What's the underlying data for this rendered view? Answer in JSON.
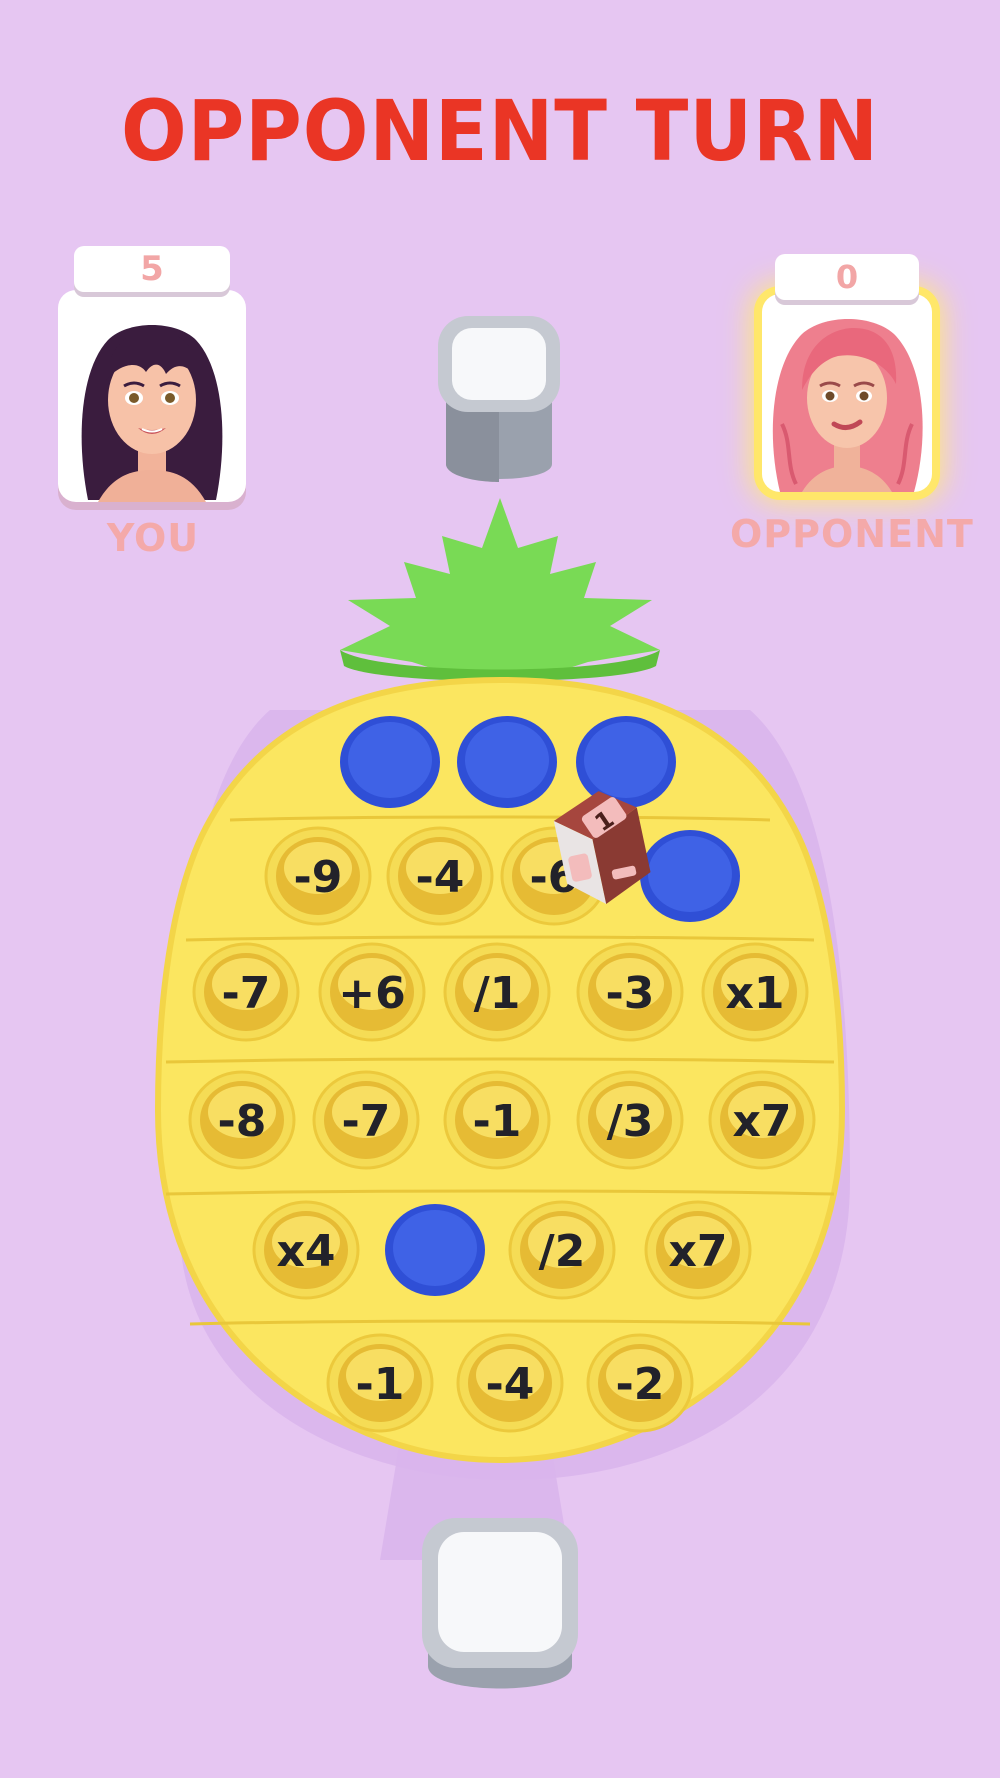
{
  "header": {
    "turn_label": "OPPONENT TURN"
  },
  "players": {
    "you": {
      "score": "5",
      "label": "YOU",
      "active": false
    },
    "opponent": {
      "score": "0",
      "label": "OPPONENT",
      "active": true
    }
  },
  "board": {
    "shape": "pineapple",
    "rows": [
      {
        "cells": [
          {
            "popped": true
          },
          {
            "popped": true
          },
          {
            "popped": true
          }
        ]
      },
      {
        "cells": [
          {
            "value": "-9"
          },
          {
            "value": "-4"
          },
          {
            "value": "-6"
          },
          {
            "popped": true
          }
        ]
      },
      {
        "cells": [
          {
            "value": "-7"
          },
          {
            "value": "+6"
          },
          {
            "value": "/1"
          },
          {
            "value": "-3"
          },
          {
            "value": "x1"
          }
        ]
      },
      {
        "cells": [
          {
            "value": "-8"
          },
          {
            "value": "-7"
          },
          {
            "value": "-1"
          },
          {
            "value": "/3"
          },
          {
            "value": "x7"
          }
        ]
      },
      {
        "cells": [
          {
            "value": "x4"
          },
          {
            "popped": true
          },
          {
            "value": "/2"
          },
          {
            "value": "x7"
          }
        ]
      },
      {
        "cells": [
          {
            "value": "-1"
          },
          {
            "value": "-4"
          },
          {
            "value": "-2"
          }
        ]
      }
    ]
  },
  "dice": {
    "face": "1"
  },
  "colors": {
    "background": "#e6c6f2",
    "title": "#ea3525",
    "board": "#fbe660",
    "leaves": "#7ddc57",
    "popped": "#3f62e6",
    "label": "#f4a9a9"
  }
}
